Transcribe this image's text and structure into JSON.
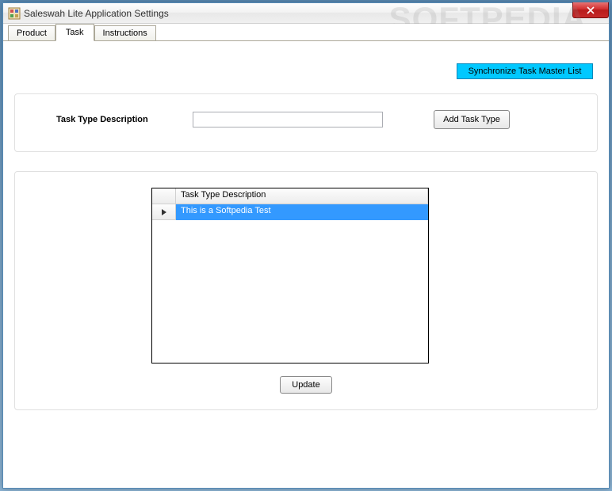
{
  "window": {
    "title": "Saleswah Lite Application Settings"
  },
  "tabs": {
    "product": "Product",
    "task": "Task",
    "instructions": "Instructions",
    "active": "task"
  },
  "sync_button_label": "Synchronize Task Master List",
  "form": {
    "task_type_label": "Task Type Description",
    "task_type_value": "",
    "add_button_label": "Add Task Type"
  },
  "grid": {
    "column_header": "Task Type Description",
    "rows": [
      {
        "value": "This is a Softpedia Test",
        "selected": true
      }
    ]
  },
  "update_button_label": "Update",
  "watermark": "SOFTPEDIA"
}
